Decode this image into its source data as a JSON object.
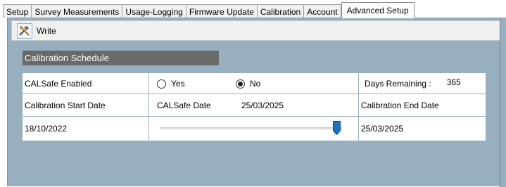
{
  "tabs": [
    {
      "label": "Setup"
    },
    {
      "label": "Survey Measurements"
    },
    {
      "label": "Usage-Logging"
    },
    {
      "label": "Firmware Update"
    },
    {
      "label": "Calibration"
    },
    {
      "label": "Account"
    },
    {
      "label": "Advanced Setup",
      "active": true
    }
  ],
  "toolbar": {
    "write_label": "Write",
    "write_icon": "write-tools-icon"
  },
  "section": {
    "title": "Calibration Schedule"
  },
  "calsafe": {
    "label": "CALSafe Enabled",
    "yes_label": "Yes",
    "no_label": "No",
    "selected": "No"
  },
  "days_remaining": {
    "label": "Days Remaining :",
    "value": "365"
  },
  "start_date": {
    "label": "Calibration Start Date",
    "value": "18/10/2022"
  },
  "calsafe_date": {
    "label": "CALSafe Date",
    "value": "25/03/2025",
    "slider_fraction": 1.0
  },
  "end_date": {
    "label": "Calibration End Date",
    "value": "25/03/2025"
  },
  "colors": {
    "panel_bg": "#98afbf",
    "header_bg": "#696969",
    "slider_thumb": "#1e73be"
  }
}
